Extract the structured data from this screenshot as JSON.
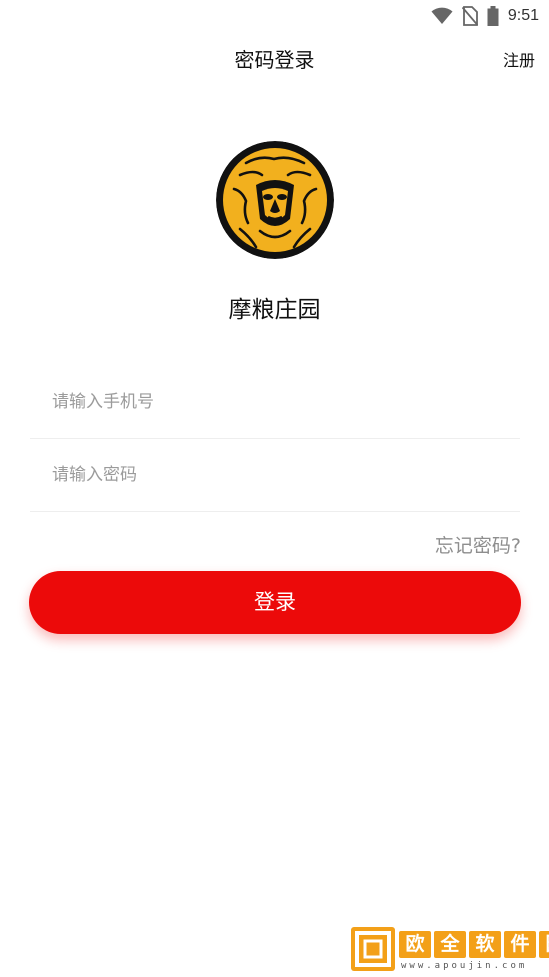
{
  "status_bar": {
    "time": "9:51"
  },
  "header": {
    "title": "密码登录",
    "register_label": "注册"
  },
  "app": {
    "name": "摩粮庄园"
  },
  "form": {
    "phone_placeholder": "请输入手机号",
    "phone_value": "",
    "password_placeholder": "请输入密码",
    "password_value": "",
    "forgot_label": "忘记密码?",
    "login_label": "登录"
  },
  "colors": {
    "accent": "#ec0a0a",
    "logo_gold": "#f2b01e",
    "logo_bg": "#111111"
  },
  "icons": [
    "wifi-icon",
    "no-sim-icon",
    "battery-icon",
    "lion-logo-icon"
  ],
  "watermark": {
    "chars": [
      "欧",
      "全",
      "软",
      "件",
      "园"
    ],
    "url": "www.apoujin.com"
  }
}
